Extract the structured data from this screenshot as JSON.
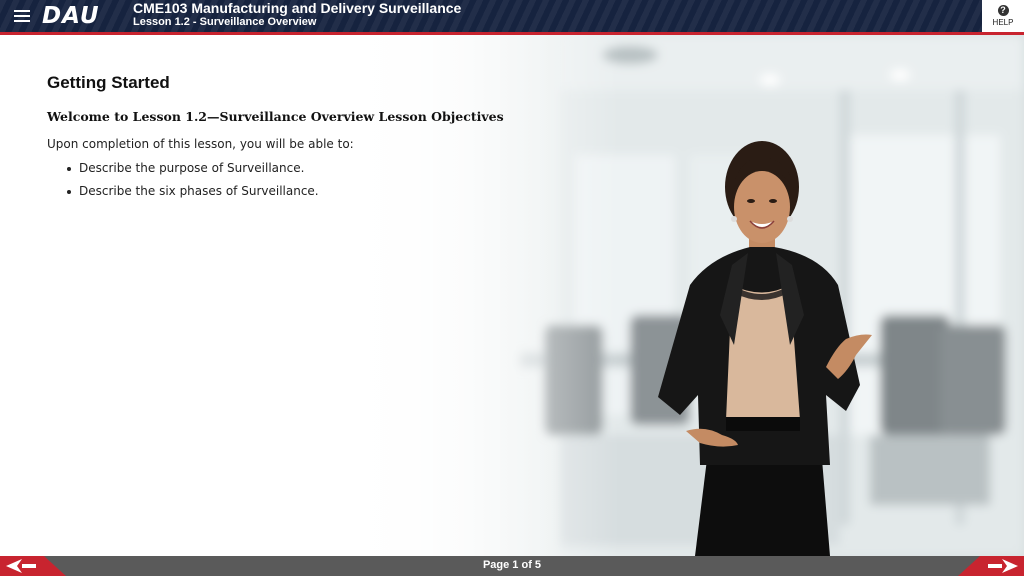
{
  "header": {
    "logo": "DAU",
    "course_title": "CME103 Manufacturing and Delivery Surveillance",
    "lesson_title": "Lesson 1.2 - Surveillance Overview",
    "help_label": "HELP",
    "help_icon_glyph": "?"
  },
  "content": {
    "heading": "Getting Started",
    "subheading": "Welcome to Lesson 1.2—Surveillance Overview Lesson Objectives",
    "intro": "Upon completion of this lesson, you will be able to:",
    "objectives": [
      "Describe the purpose of Surveillance.",
      "Describe the six phases of Surveillance."
    ]
  },
  "footer": {
    "page_label": "Page 1 of 5"
  },
  "colors": {
    "header_bg": "#16233f",
    "accent_red": "#c8242f",
    "footer_bg": "#5a5a5a"
  },
  "icons": {
    "menu": "hamburger-menu-icon",
    "help": "question-mark-icon",
    "prev": "arrow-left-icon",
    "next": "arrow-right-icon"
  }
}
